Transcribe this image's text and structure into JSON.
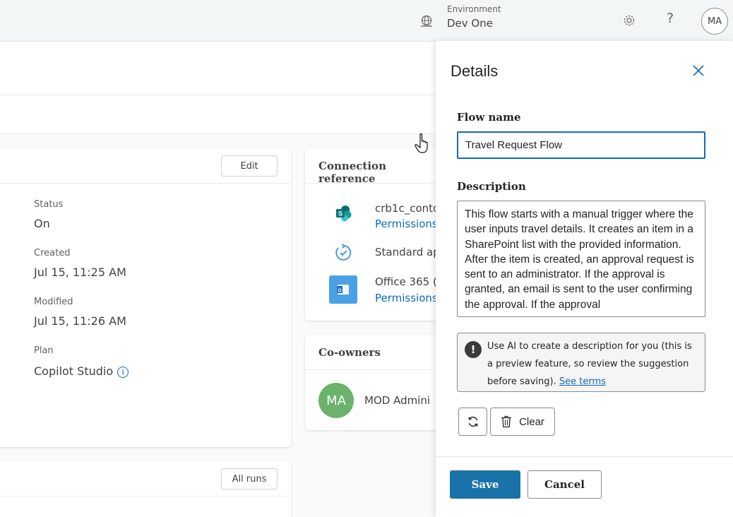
{
  "topbar": {
    "environment_label": "Environment",
    "environment_value": "Dev One",
    "environment_icon": "globe-icon",
    "settings_icon": "gear-icon",
    "help_label": "?",
    "avatar_initials": "MA"
  },
  "flow_card": {
    "edit_label": "Edit",
    "status_label": "Status",
    "status_value": "On",
    "created_label": "Created",
    "created_value": "Jul 15, 11:25 AM",
    "modified_label": "Modified",
    "modified_value": "Jul 15, 11:26 AM",
    "plan_label": "Plan",
    "plan_value": "Copilot Studio",
    "plan_info_icon": "i"
  },
  "connections": {
    "title": "Connection reference",
    "items": [
      {
        "name": "crb1c_conto",
        "permissions": "Permissions",
        "icon": "sharepoint-icon"
      },
      {
        "name": "Standard ap",
        "icon": "approvals-icon"
      },
      {
        "name": "Office 365 (",
        "permissions": "Permissions",
        "icon": "outlook-icon"
      }
    ]
  },
  "coowners": {
    "title": "Co-owners",
    "owner_initials": "MA",
    "owner_name": "MOD Admini"
  },
  "runs": {
    "all_runs_label": "All runs"
  },
  "details": {
    "title": "Details",
    "flow_name_label": "Flow name",
    "flow_name_value": "Travel Request Flow",
    "description_label": "Description",
    "description_value": "This flow starts with a manual trigger where the user inputs travel details. It creates an item in a SharePoint list with the provided information. After the item is created, an approval request is sent to an administrator. If the approval is granted, an email is sent to the user confirming the approval. If the approval",
    "ai_note_text": "Use AI to create a description for you (this is a preview feature, so review the suggestion before saving).",
    "ai_note_link": "See terms",
    "ai_note_icon": "!",
    "clear_label": "Clear",
    "save_label": "Save",
    "cancel_label": "Cancel"
  },
  "colors": {
    "accent": "#0f6cbd",
    "save_button": "#1a73a8",
    "owner_avatar": "#6bb26b"
  }
}
